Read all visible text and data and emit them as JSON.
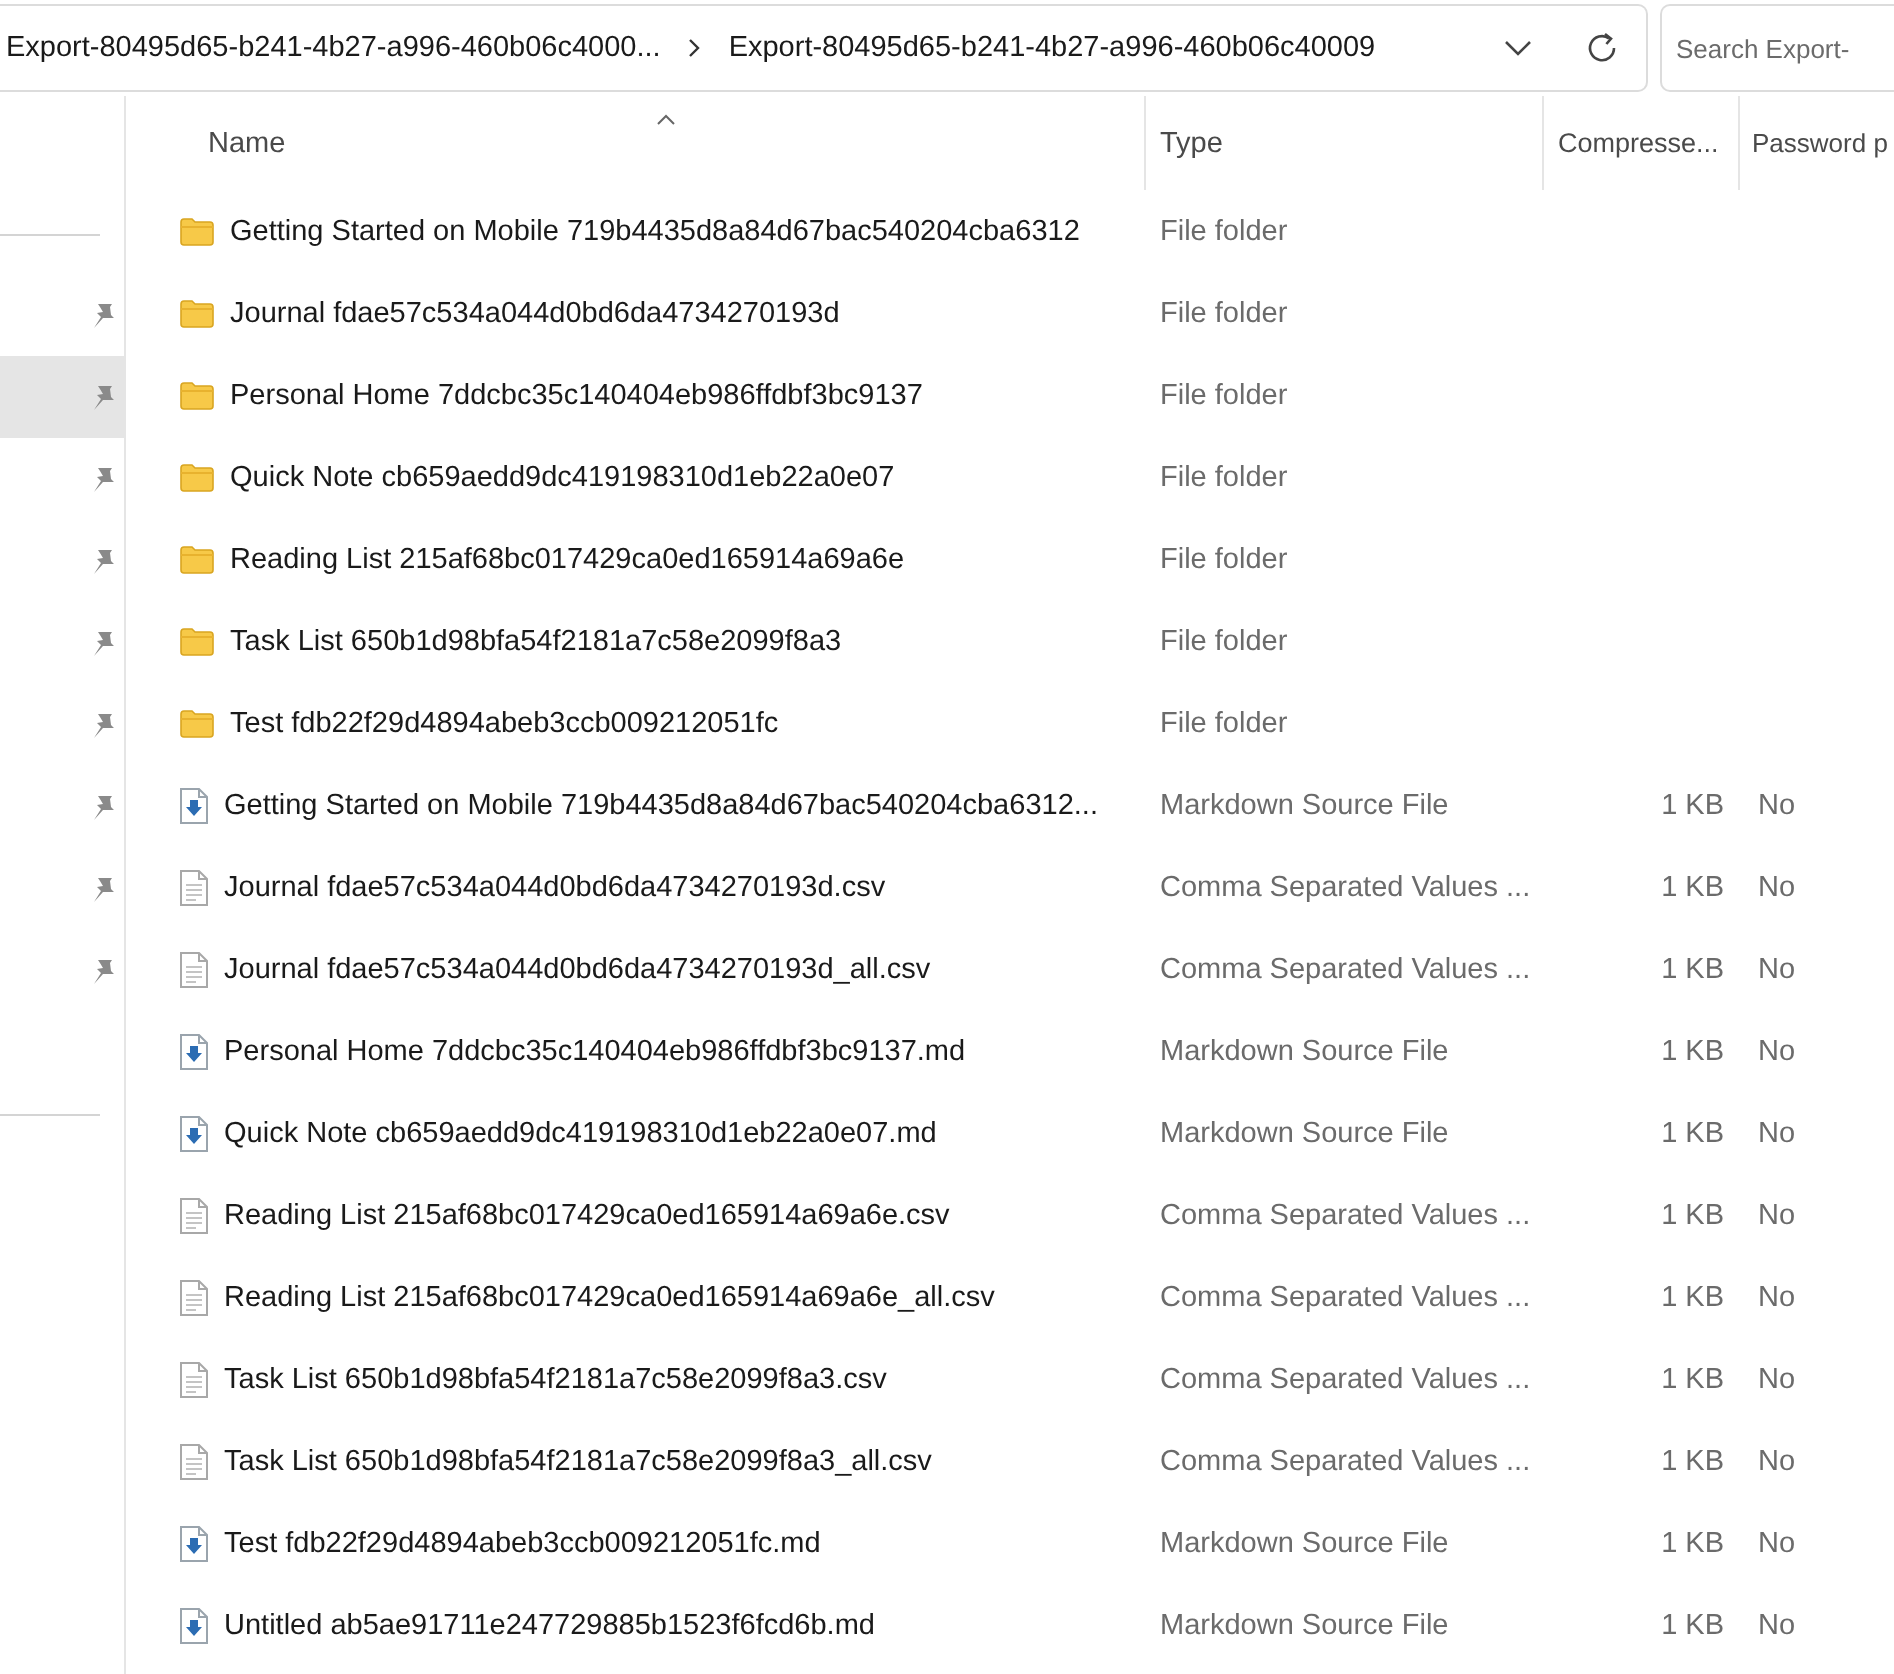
{
  "address_bar": {
    "crumbs": [
      "Export-80495d65-b241-4b27-a996-460b06c4000...",
      "Export-80495d65-b241-4b27-a996-460b06c40009"
    ]
  },
  "search": {
    "placeholder": "Search Export-"
  },
  "sidebar": {
    "items": [
      {
        "selected": false
      },
      {
        "selected": true
      },
      {
        "selected": false
      },
      {
        "selected": false
      },
      {
        "selected": false
      },
      {
        "selected": false
      },
      {
        "selected": false
      },
      {
        "selected": false
      },
      {
        "selected": false
      }
    ]
  },
  "table": {
    "columns": [
      "Name",
      "Type",
      "Compresse...",
      "Password p"
    ],
    "rows": [
      {
        "kind": "folder",
        "name": "Getting Started on Mobile 719b4435d8a84d67bac540204cba6312",
        "type": "File folder"
      },
      {
        "kind": "folder",
        "name": "Journal fdae57c534a044d0bd6da4734270193d",
        "type": "File folder"
      },
      {
        "kind": "folder",
        "name": "Personal Home 7ddcbc35c140404eb986ffdbf3bc9137",
        "type": "File folder"
      },
      {
        "kind": "folder",
        "name": "Quick Note cb659aedd9dc419198310d1eb22a0e07",
        "type": "File folder"
      },
      {
        "kind": "folder",
        "name": "Reading List 215af68bc017429ca0ed165914a69a6e",
        "type": "File folder"
      },
      {
        "kind": "folder",
        "name": "Task List 650b1d98bfa54f2181a7c58e2099f8a3",
        "type": "File folder"
      },
      {
        "kind": "folder",
        "name": "Test fdb22f29d4894abeb3ccb009212051fc",
        "type": "File folder"
      },
      {
        "kind": "markdown",
        "name": "Getting Started on Mobile 719b4435d8a84d67bac540204cba6312...",
        "type": "Markdown Source File",
        "size": "1 KB",
        "password": "No"
      },
      {
        "kind": "csv",
        "name": "Journal fdae57c534a044d0bd6da4734270193d.csv",
        "type": "Comma Separated Values ...",
        "size": "1 KB",
        "password": "No"
      },
      {
        "kind": "csv",
        "name": "Journal fdae57c534a044d0bd6da4734270193d_all.csv",
        "type": "Comma Separated Values ...",
        "size": "1 KB",
        "password": "No"
      },
      {
        "kind": "markdown",
        "name": "Personal Home 7ddcbc35c140404eb986ffdbf3bc9137.md",
        "type": "Markdown Source File",
        "size": "1 KB",
        "password": "No"
      },
      {
        "kind": "markdown",
        "name": "Quick Note cb659aedd9dc419198310d1eb22a0e07.md",
        "type": "Markdown Source File",
        "size": "1 KB",
        "password": "No"
      },
      {
        "kind": "csv",
        "name": "Reading List 215af68bc017429ca0ed165914a69a6e.csv",
        "type": "Comma Separated Values ...",
        "size": "1 KB",
        "password": "No"
      },
      {
        "kind": "csv",
        "name": "Reading List 215af68bc017429ca0ed165914a69a6e_all.csv",
        "type": "Comma Separated Values ...",
        "size": "1 KB",
        "password": "No"
      },
      {
        "kind": "csv",
        "name": "Task List 650b1d98bfa54f2181a7c58e2099f8a3.csv",
        "type": "Comma Separated Values ...",
        "size": "1 KB",
        "password": "No"
      },
      {
        "kind": "csv",
        "name": "Task List 650b1d98bfa54f2181a7c58e2099f8a3_all.csv",
        "type": "Comma Separated Values ...",
        "size": "1 KB",
        "password": "No"
      },
      {
        "kind": "markdown",
        "name": "Test fdb22f29d4894abeb3ccb009212051fc.md",
        "type": "Markdown Source File",
        "size": "1 KB",
        "password": "No"
      },
      {
        "kind": "markdown",
        "name": "Untitled ab5ae91711e247729885b1523f6fcd6b.md",
        "type": "Markdown Source File",
        "size": "1 KB",
        "password": "No"
      }
    ]
  }
}
